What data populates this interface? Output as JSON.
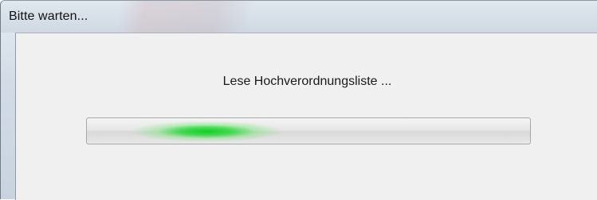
{
  "window": {
    "title": "Bitte warten..."
  },
  "dialog": {
    "message": "Lese Hochverordnungsliste ...",
    "progress": {
      "mode": "indeterminate",
      "marquee_position": 0.27,
      "color": "#1fd13a"
    }
  }
}
